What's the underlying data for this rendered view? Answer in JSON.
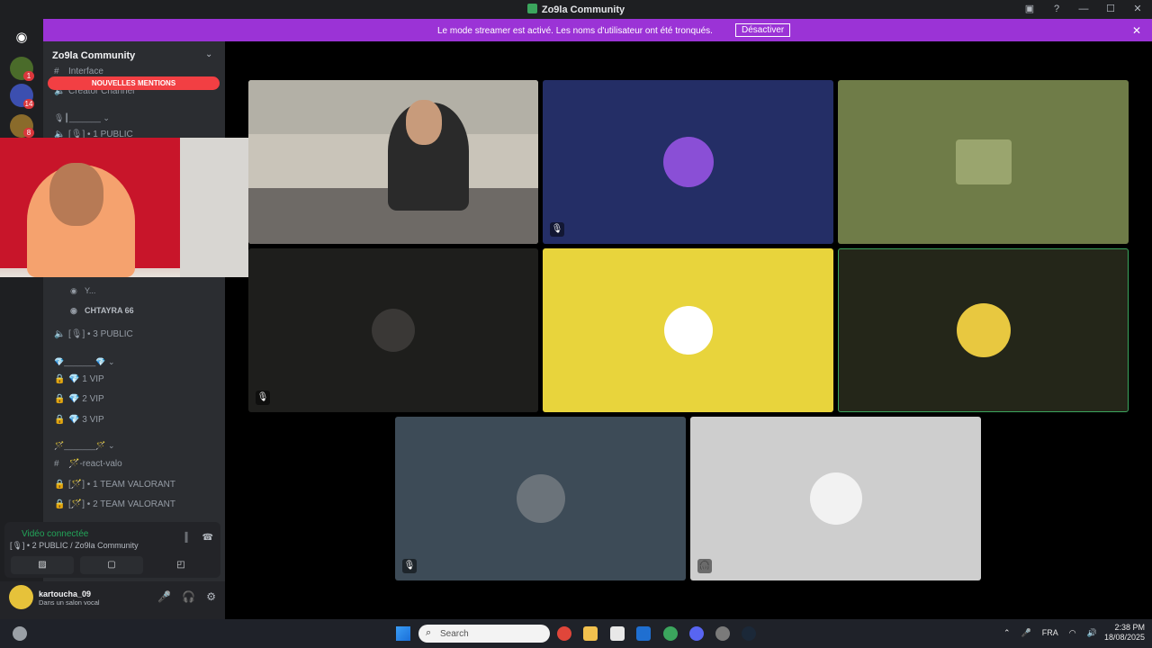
{
  "window": {
    "title": "Zo9la Community"
  },
  "banner": {
    "text": "Le mode streamer est activé. Les noms d'utilisateur ont été tronqués.",
    "button": "Désactiver"
  },
  "server_badges": [
    "1",
    "14",
    "8"
  ],
  "guild": {
    "name": "Zo9la Community"
  },
  "channels": {
    "top": [
      "Interface",
      "Creator Channel",
      "🎙┃_______ ⌄",
      "[🎙] • 1 PUBLIC"
    ],
    "mentions": "NOUVELLES MENTIONS",
    "members": [
      "Y...",
      "CHTAYRA 66"
    ],
    "public3": "[🎙] • 3 PUBLIC",
    "vip_category": "💎_______💎 ⌄",
    "vip": [
      "💎 1 VIP",
      "💎 2 VIP",
      "💎 3 VIP"
    ],
    "valo_category": "🪄_______🪄 ⌄",
    "valo_text": "🪄-react-valo",
    "valo_voice": [
      "[🪄] • 1 TEAM VALORANT",
      "[🪄] • 2 TEAM VALORANT"
    ]
  },
  "voice": {
    "status": "Vidéo connectée",
    "channel": "[🎙] • 2 PUBLIC / Zo9la Community"
  },
  "user": {
    "name": "kartoucha_09",
    "status": "Dans un salon vocal"
  },
  "taskbar": {
    "search": "Search",
    "lang": "FRA",
    "time": "2:38 PM",
    "date": "18/08/2025"
  },
  "colors": {
    "banner": "#9b33d6",
    "connected": "#23a559",
    "tile_navy": "#242e66",
    "tile_olive": "#6f7c48",
    "tile_dark": "#1e1e1c",
    "tile_yellow": "#e8d43c",
    "tile_darkolive": "#242619",
    "tile_slate": "#3d4b57",
    "tile_light": "#cecece"
  }
}
